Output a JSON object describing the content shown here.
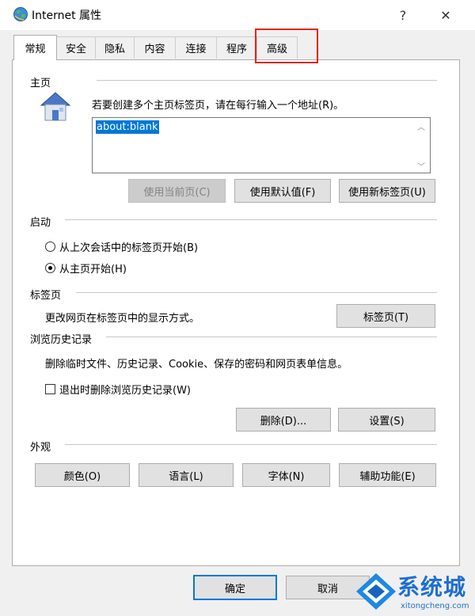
{
  "window": {
    "title": "Internet 属性",
    "help_label": "?",
    "close_label": "✕"
  },
  "tabs": [
    {
      "label": "常规"
    },
    {
      "label": "安全"
    },
    {
      "label": "隐私"
    },
    {
      "label": "内容"
    },
    {
      "label": "连接"
    },
    {
      "label": "程序"
    },
    {
      "label": "高级"
    }
  ],
  "home": {
    "group_label": "主页",
    "instruction": "若要创建多个主页标签页，请在每行输入一个地址(R)。",
    "url_value": "about:blank",
    "btn_current": "使用当前页(C)",
    "btn_default": "使用默认值(F)",
    "btn_newtab": "使用新标签页(U)"
  },
  "startup": {
    "group_label": "启动",
    "option_last_session": "从上次会话中的标签页开始(B)",
    "option_home": "从主页开始(H)"
  },
  "tabs_section": {
    "group_label": "标签页",
    "description": "更改网页在标签页中的显示方式。",
    "btn_tabs": "标签页(T)"
  },
  "history": {
    "group_label": "浏览历史记录",
    "description": "删除临时文件、历史记录、Cookie、保存的密码和网页表单信息。",
    "checkbox_delete_on_exit": "退出时删除浏览历史记录(W)",
    "btn_delete": "删除(D)...",
    "btn_settings": "设置(S)"
  },
  "appearance": {
    "group_label": "外观",
    "btn_colors": "颜色(O)",
    "btn_languages": "语言(L)",
    "btn_fonts": "字体(N)",
    "btn_accessibility": "辅助功能(E)"
  },
  "footer": {
    "btn_ok": "确定",
    "btn_cancel": "取消"
  },
  "watermark": {
    "brand": "系统城",
    "url": "xitongcheng.com"
  }
}
